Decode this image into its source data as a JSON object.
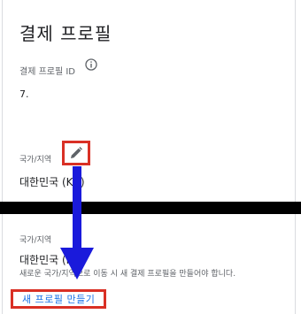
{
  "header": {
    "title": "결제 프로필"
  },
  "profile_id": {
    "label": "결제 프로필 ID",
    "value": "7.",
    "info_icon": "info-icon"
  },
  "country": {
    "label": "국가/지역",
    "value": "대한민국 (KR)",
    "edit_icon": "pencil-icon"
  },
  "edit_section": {
    "label": "국가/지역",
    "value": "대한민국 (KR)",
    "notice": "새로운 국가/지역으로 이동 시 새 결제 프로필을 만들어야 합니다.",
    "create_button": "새 프로필 만들기"
  },
  "annotation": {
    "highlight_color": "#d93025",
    "arrow_color": "#1a1adb",
    "band_color": "#000000"
  }
}
